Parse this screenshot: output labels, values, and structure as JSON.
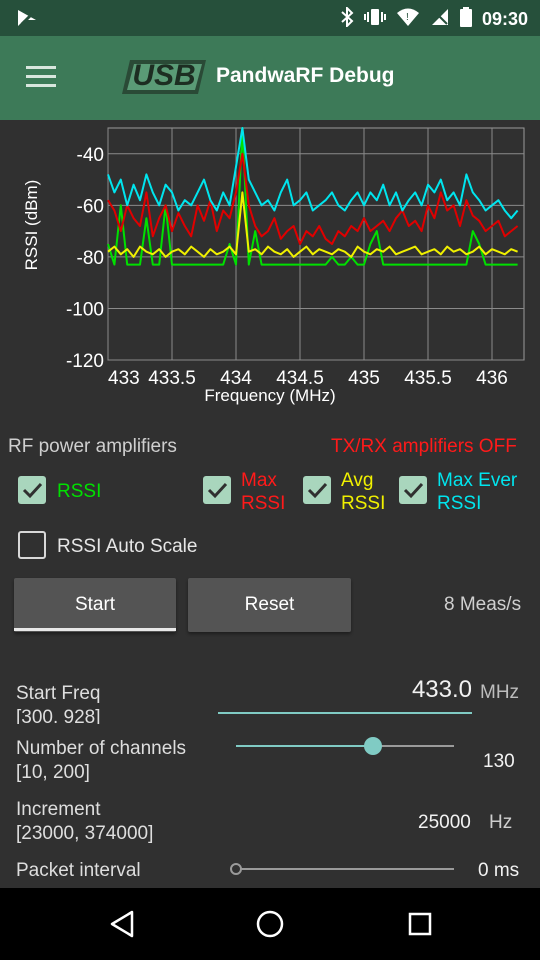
{
  "status_bar": {
    "time": "09:30",
    "icons": [
      "notification-icon",
      "bluetooth-icon",
      "vibrate-icon",
      "wifi-icon",
      "no-sim-icon",
      "battery-icon"
    ]
  },
  "app_bar": {
    "logo_text": "USB",
    "title": "PandwaRF  Debug"
  },
  "chart_data": {
    "type": "line",
    "xlabel": "Frequency (MHz)",
    "ylabel": "RSSI (dBm)",
    "xlim": [
      433,
      436.25
    ],
    "ylim": [
      -120,
      -30
    ],
    "x_ticks": [
      "433",
      "433.5",
      "434",
      "434.5",
      "435",
      "435.5",
      "436"
    ],
    "y_ticks": [
      "-40",
      "-60",
      "-80",
      "-100",
      "-120"
    ],
    "grid": true,
    "series": [
      {
        "name": "RSSI",
        "color": "#00e000",
        "x": [
          433.0,
          433.05,
          433.1,
          433.15,
          433.2,
          433.25,
          433.3,
          433.35,
          433.4,
          433.45,
          433.5,
          433.55,
          433.6,
          433.65,
          433.7,
          433.75,
          433.8,
          433.85,
          433.9,
          433.95,
          434.0,
          434.05,
          434.1,
          434.15,
          434.2,
          434.25,
          434.3,
          434.35,
          434.4,
          434.45,
          434.5,
          434.55,
          434.6,
          434.65,
          434.7,
          434.75,
          434.8,
          434.85,
          434.9,
          434.95,
          435.0,
          435.05,
          435.1,
          435.15,
          435.2,
          435.25,
          435.3,
          435.35,
          435.4,
          435.45,
          435.5,
          435.55,
          435.6,
          435.65,
          435.7,
          435.75,
          435.8,
          435.85,
          435.9,
          435.95,
          436.0,
          436.05,
          436.1,
          436.15,
          436.2
        ],
        "y": [
          -75,
          -83,
          -60,
          -83,
          -83,
          -83,
          -65,
          -83,
          -83,
          -60,
          -83,
          -83,
          -83,
          -83,
          -83,
          -83,
          -83,
          -83,
          -83,
          -75,
          -83,
          -30,
          -83,
          -70,
          -83,
          -83,
          -83,
          -83,
          -83,
          -83,
          -83,
          -83,
          -83,
          -83,
          -83,
          -80,
          -83,
          -83,
          -80,
          -83,
          -83,
          -75,
          -70,
          -83,
          -83,
          -83,
          -83,
          -83,
          -83,
          -83,
          -83,
          -83,
          -83,
          -83,
          -83,
          -83,
          -83,
          -70,
          -75,
          -83,
          -83,
          -83,
          -83,
          -83,
          -83
        ]
      },
      {
        "name": "Max RSSI",
        "color": "#e00000",
        "x": [
          433.0,
          433.05,
          433.1,
          433.15,
          433.2,
          433.25,
          433.3,
          433.35,
          433.4,
          433.45,
          433.5,
          433.55,
          433.6,
          433.65,
          433.7,
          433.75,
          433.8,
          433.85,
          433.9,
          433.95,
          434.0,
          434.05,
          434.1,
          434.15,
          434.2,
          434.25,
          434.3,
          434.35,
          434.4,
          434.45,
          434.5,
          434.55,
          434.6,
          434.65,
          434.7,
          434.75,
          434.8,
          434.85,
          434.9,
          434.95,
          435.0,
          435.05,
          435.1,
          435.15,
          435.2,
          435.25,
          435.3,
          435.35,
          435.4,
          435.45,
          435.5,
          435.55,
          435.6,
          435.65,
          435.7,
          435.75,
          435.8,
          435.85,
          435.9,
          435.95,
          436.0,
          436.05,
          436.1,
          436.15,
          436.2
        ],
        "y": [
          -58,
          -62,
          -70,
          -60,
          -65,
          -68,
          -55,
          -72,
          -65,
          -60,
          -70,
          -63,
          -68,
          -72,
          -60,
          -66,
          -58,
          -70,
          -62,
          -65,
          -55,
          -40,
          -60,
          -68,
          -72,
          -70,
          -65,
          -73,
          -70,
          -68,
          -75,
          -70,
          -72,
          -68,
          -73,
          -75,
          -70,
          -72,
          -68,
          -70,
          -65,
          -70,
          -68,
          -66,
          -70,
          -65,
          -62,
          -68,
          -66,
          -70,
          -60,
          -65,
          -55,
          -62,
          -60,
          -68,
          -58,
          -64,
          -66,
          -70,
          -68,
          -66,
          -72,
          -70,
          -68
        ]
      },
      {
        "name": "Avg RSSI",
        "color": "#f0f000",
        "x": [
          433.0,
          433.05,
          433.1,
          433.15,
          433.2,
          433.25,
          433.3,
          433.35,
          433.4,
          433.45,
          433.5,
          433.55,
          433.6,
          433.65,
          433.7,
          433.75,
          433.8,
          433.85,
          433.9,
          433.95,
          434.0,
          434.05,
          434.1,
          434.15,
          434.2,
          434.25,
          434.3,
          434.35,
          434.4,
          434.45,
          434.5,
          434.55,
          434.6,
          434.65,
          434.7,
          434.75,
          434.8,
          434.85,
          434.9,
          434.95,
          435.0,
          435.05,
          435.1,
          435.15,
          435.2,
          435.25,
          435.3,
          435.35,
          435.4,
          435.45,
          435.5,
          435.55,
          435.6,
          435.65,
          435.7,
          435.75,
          435.8,
          435.85,
          435.9,
          435.95,
          436.0,
          436.05,
          436.1,
          436.15,
          436.2
        ],
        "y": [
          -78,
          -76,
          -79,
          -77,
          -80,
          -76,
          -78,
          -79,
          -77,
          -80,
          -78,
          -77,
          -79,
          -76,
          -78,
          -80,
          -77,
          -79,
          -78,
          -76,
          -79,
          -55,
          -78,
          -77,
          -79,
          -76,
          -78,
          -79,
          -77,
          -80,
          -78,
          -76,
          -79,
          -77,
          -78,
          -79,
          -77,
          -78,
          -80,
          -76,
          -78,
          -79,
          -77,
          -78,
          -76,
          -79,
          -78,
          -77,
          -76,
          -79,
          -78,
          -77,
          -79,
          -76,
          -78,
          -77,
          -79,
          -78,
          -76,
          -79,
          -77,
          -78,
          -79,
          -77,
          -78
        ]
      },
      {
        "name": "Max Ever RSSI",
        "color": "#00e5ee",
        "x": [
          433.0,
          433.05,
          433.1,
          433.15,
          433.2,
          433.25,
          433.3,
          433.35,
          433.4,
          433.45,
          433.5,
          433.55,
          433.6,
          433.65,
          433.7,
          433.75,
          433.8,
          433.85,
          433.9,
          433.95,
          434.0,
          434.05,
          434.1,
          434.15,
          434.2,
          434.25,
          434.3,
          434.35,
          434.4,
          434.45,
          434.5,
          434.55,
          434.6,
          434.65,
          434.7,
          434.75,
          434.8,
          434.85,
          434.9,
          434.95,
          435.0,
          435.05,
          435.1,
          435.15,
          435.2,
          435.25,
          435.3,
          435.35,
          435.4,
          435.45,
          435.5,
          435.55,
          435.6,
          435.65,
          435.7,
          435.75,
          435.8,
          435.85,
          435.9,
          435.95,
          436.0,
          436.05,
          436.1,
          436.15,
          436.2
        ],
        "y": [
          -48,
          -55,
          -50,
          -60,
          -52,
          -58,
          -48,
          -55,
          -60,
          -52,
          -55,
          -62,
          -58,
          -60,
          -55,
          -50,
          -58,
          -62,
          -55,
          -60,
          -45,
          -30,
          -50,
          -55,
          -60,
          -58,
          -62,
          -55,
          -50,
          -60,
          -58,
          -55,
          -62,
          -60,
          -58,
          -55,
          -60,
          -62,
          -58,
          -55,
          -60,
          -55,
          -58,
          -52,
          -60,
          -55,
          -62,
          -58,
          -55,
          -60,
          -52,
          -55,
          -50,
          -58,
          -55,
          -60,
          -48,
          -55,
          -58,
          -62,
          -60,
          -58,
          -62,
          -65,
          -62
        ]
      }
    ]
  },
  "controls": {
    "rf_amp_label": "RF power amplifiers",
    "txrx_status": "TX/RX amplifiers OFF",
    "checkboxes": {
      "rssi": "RSSI",
      "max_rssi_1": "Max",
      "max_rssi_2": "RSSI",
      "avg_rssi_1": "Avg",
      "avg_rssi_2": "RSSI",
      "max_ever_1": "Max Ever",
      "max_ever_2": "RSSI",
      "auto_scale": "RSSI Auto Scale"
    },
    "start_button": "Start",
    "reset_button": "Reset",
    "meas_rate": "8 Meas/s"
  },
  "settings": {
    "start_freq_label": "Start Freq",
    "start_freq_range": "[300. 928]",
    "start_freq_value": "433.0",
    "start_freq_unit": "MHz",
    "channels_label": "Number of channels",
    "channels_range": "[10, 200]",
    "channels_value": "130",
    "channels_fraction": 0.63,
    "increment_label": "Increment",
    "increment_range": "[23000, 374000]",
    "increment_value": "25000",
    "increment_unit": "Hz",
    "packet_label": "Packet interval",
    "packet_value": "0 ms",
    "packet_fraction": 0.0
  }
}
